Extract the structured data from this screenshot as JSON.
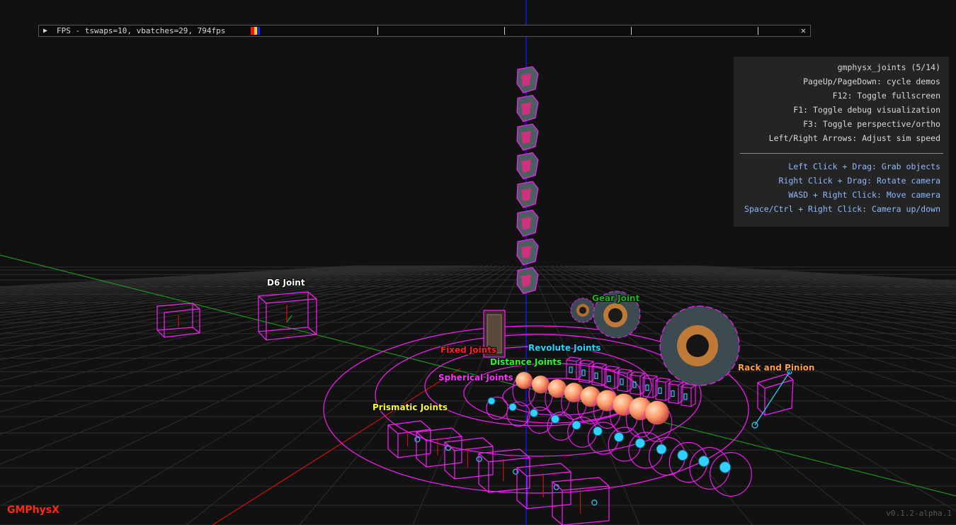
{
  "fps": {
    "play_glyph": "▶",
    "text": "FPS - tswaps=10, vbatches=29, 794fps",
    "close_glyph": "✕",
    "gauge_colors": [
      "#ff1010",
      "#ffd800",
      "#1020ff"
    ]
  },
  "help": {
    "title": "gmphysx_joints (5/14)",
    "keys": [
      "PageUp/PageDown: cycle demos",
      "F12: Toggle fullscreen",
      "F1: Toggle debug visualization",
      "F3: Toggle perspective/ortho",
      "Left/Right Arrows: Adjust sim speed"
    ],
    "mouse": [
      "Left Click + Drag: Grab objects",
      "Right Click + Drag: Rotate camera",
      "WASD + Right Click: Move camera",
      "Space/Ctrl + Right Click: Camera up/down"
    ]
  },
  "labels": {
    "d6": "D6 Joint",
    "gear": "Gear Joint",
    "fixed": "Fixed Joints",
    "revolute": "Revolute Joints",
    "distance": "Distance Joints",
    "spherical": "Spherical Joints",
    "prismatic": "Prismatic Joints",
    "rack": "Rack and Pinion"
  },
  "colors": {
    "debug_magenta": "#ff1cff",
    "axis_x": "#d01010",
    "axis_y": "#1aa01a",
    "axis_z": "#1a1aff",
    "label_d6": "#ffffff",
    "label_gear": "#14b814",
    "label_fixed": "#ff2020",
    "label_revolute": "#20d8ff",
    "label_distance": "#20ff20",
    "label_spherical": "#ff30ff",
    "label_prismatic": "#ffff20",
    "label_rack": "#ffa040",
    "brand": "#ff2a10"
  },
  "footer": {
    "brand": "GMPhysX",
    "version": "v0.1.2-alpha.1"
  }
}
